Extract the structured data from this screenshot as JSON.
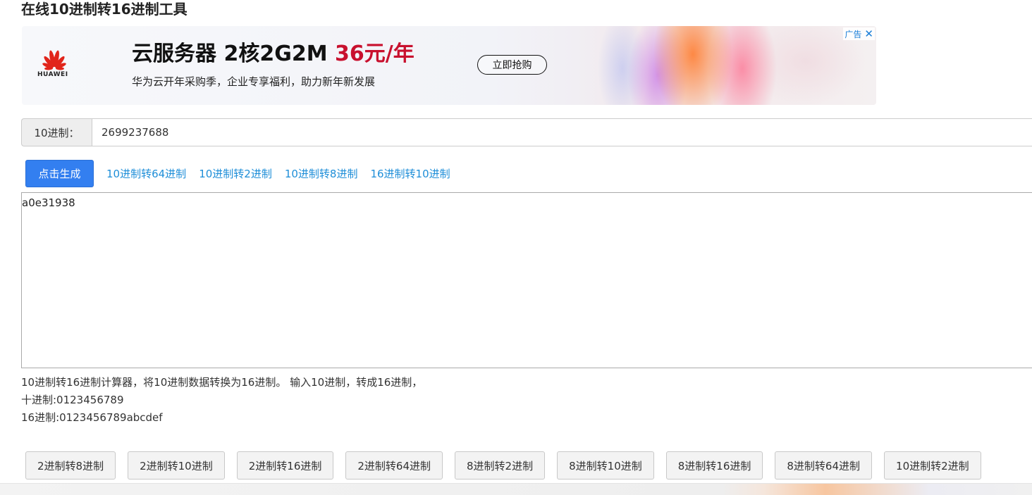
{
  "page": {
    "title": "在线10进制转16进制工具"
  },
  "ad": {
    "brand": "HUAWEI",
    "headline_main": "云服务器 2核2G2M ",
    "headline_price": "36元/年",
    "subline": "华为云开年采购季，企业专享福利，助力新年新发展",
    "cta": "立即抢购",
    "ad_label": "广告",
    "close_glyph": "✕",
    "colors": {
      "price": "#c8102e",
      "logo": "#e1251b"
    }
  },
  "input": {
    "label": "10进制：",
    "value": "2699237688"
  },
  "actions": {
    "generate_label": "点击生成",
    "links": [
      "10进制转64进制",
      "10进制转2进制",
      "10进制转8进制",
      "16进制转10进制"
    ],
    "primary_color": "#337ff0",
    "link_color": "#1e8ed8"
  },
  "output": {
    "value": "a0e31938"
  },
  "description": {
    "line1": "10进制转16进制计算器，将10进制数据转换为16进制。 输入10进制，转成16进制，",
    "line2": "十进制:0123456789",
    "line3": "16进制:0123456789abcdef"
  },
  "conversions": [
    "2进制转8进制",
    "2进制转10进制",
    "2进制转16进制",
    "2进制转64进制",
    "8进制转2进制",
    "8进制转10进制",
    "8进制转16进制",
    "8进制转64进制",
    "10进制转2进制"
  ]
}
